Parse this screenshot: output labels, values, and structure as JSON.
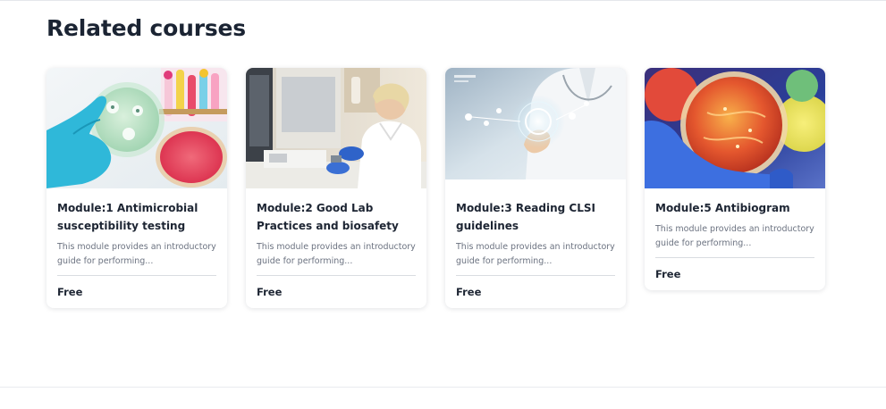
{
  "section": {
    "title": "Related courses"
  },
  "courses": [
    {
      "title": "Module:1 Antimicrobial susceptibility testing",
      "description": "This module provides an introductory guide for performing...",
      "price": "Free",
      "image_icon": "petri-dish-image"
    },
    {
      "title": "Module:2 Good Lab Practices and biosafety",
      "description": "This module provides an introductory guide for performing...",
      "price": "Free",
      "image_icon": "lab-scientist-image"
    },
    {
      "title": "Module:3 Reading CLSI guidelines",
      "description": "This module provides an introductory guide for performing...",
      "price": "Free",
      "image_icon": "digital-doctor-image"
    },
    {
      "title": "Module:5 Antibiogram",
      "description": "This module provides an introductory guide for performing...",
      "price": "Free",
      "image_icon": "culture-plate-image"
    }
  ]
}
